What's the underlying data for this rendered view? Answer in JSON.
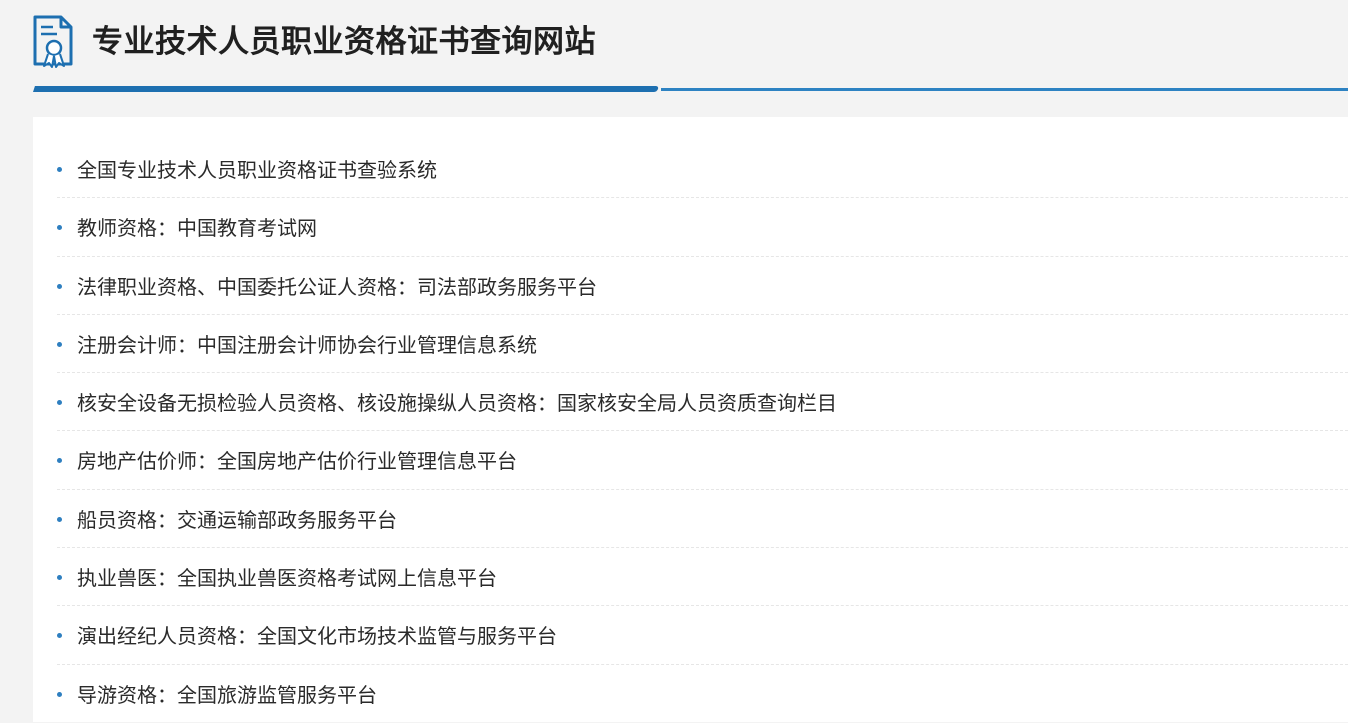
{
  "header": {
    "title": "专业技术人员职业资格证书查询网站",
    "logo_icon": "certificate-icon",
    "accent_color": "#1d6fb0"
  },
  "list": {
    "items": [
      {
        "label": "全国专业技术人员职业资格证书查验系统"
      },
      {
        "label": "教师资格：中国教育考试网"
      },
      {
        "label": "法律职业资格、中国委托公证人资格：司法部政务服务平台"
      },
      {
        "label": "注册会计师：中国注册会计师协会行业管理信息系统"
      },
      {
        "label": "核安全设备无损检验人员资格、核设施操纵人员资格：国家核安全局人员资质查询栏目"
      },
      {
        "label": "房地产估价师：全国房地产估价行业管理信息平台"
      },
      {
        "label": "船员资格：交通运输部政务服务平台"
      },
      {
        "label": "执业兽医：全国执业兽医资格考试网上信息平台"
      },
      {
        "label": "演出经纪人员资格：全国文化市场技术监管与服务平台"
      },
      {
        "label": "导游资格：全国旅游监管服务平台"
      }
    ]
  }
}
